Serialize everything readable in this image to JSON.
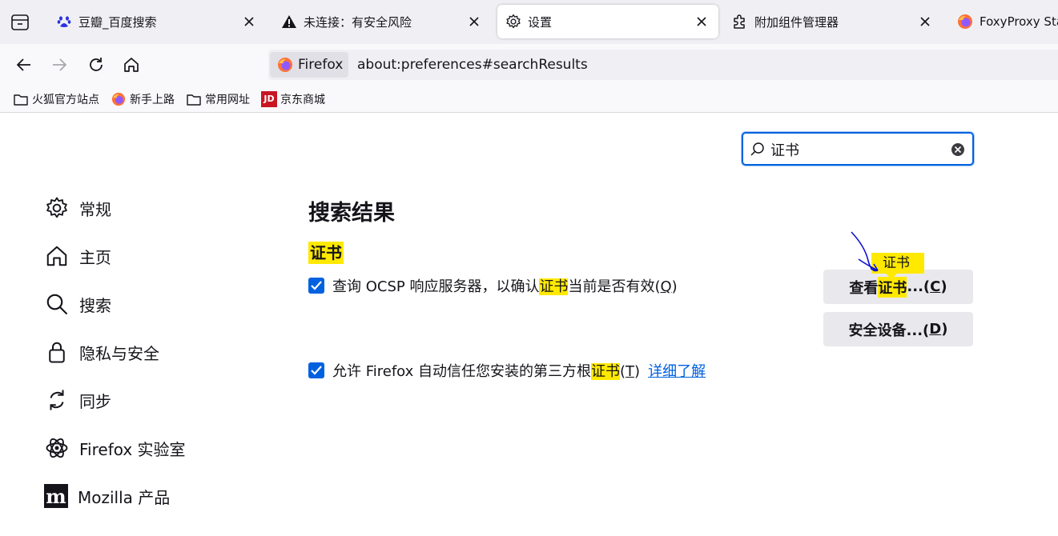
{
  "tabs": [
    {
      "label": "豆瓣_百度搜索",
      "icon": "baidu-paw-icon"
    },
    {
      "label": "未连接：有安全风险",
      "icon": "warning-icon"
    },
    {
      "label": "设置",
      "icon": "gear-icon",
      "selected": true
    },
    {
      "label": "附加组件管理器",
      "icon": "puzzle-icon"
    },
    {
      "label": "FoxyProxy Stan",
      "icon": "firefox-icon"
    }
  ],
  "urlbar": {
    "identity_label": "Firefox",
    "url": "about:preferences#searchResults"
  },
  "bookmarks": [
    {
      "label": "火狐官方站点",
      "icon": "folder-icon"
    },
    {
      "label": "新手上路",
      "icon": "firefox-icon"
    },
    {
      "label": "常用网址",
      "icon": "folder-icon"
    },
    {
      "label": "京东商城",
      "icon": "jd-icon",
      "icon_text": "JD"
    }
  ],
  "search": {
    "value": "证书"
  },
  "sidebar": {
    "items": [
      {
        "label": "常规",
        "icon": "gear-icon"
      },
      {
        "label": "主页",
        "icon": "home-icon"
      },
      {
        "label": "搜索",
        "icon": "search-icon"
      },
      {
        "label": "隐私与安全",
        "icon": "lock-icon"
      },
      {
        "label": "同步",
        "icon": "sync-icon"
      },
      {
        "label": "Firefox 实验室",
        "icon": "labs-icon"
      },
      {
        "label": "Mozilla 产品",
        "icon": "mozilla-icon",
        "icon_text": "m"
      }
    ]
  },
  "main": {
    "title": "搜索结果",
    "section_heading": "证书",
    "ocsp": {
      "before": "查询 OCSP 响应服务器，以确认",
      "highlight": "证书",
      "after": "当前是否有效(",
      "key": "Q",
      "end": ")"
    },
    "third_party": {
      "before": "允许 Firefox 自动信任您安装的第三方根",
      "highlight": "证书",
      "after": "(",
      "key": "T",
      "end": ")",
      "link": "详细了解"
    },
    "view_cert_button": {
      "before": "查看",
      "highlight": "证书",
      "after": "...(",
      "key": "C",
      "end": ")"
    },
    "security_devices_button": {
      "before": "安全设备...(",
      "key": "D",
      "end": ")"
    },
    "tooltip": "证书"
  },
  "colors": {
    "accent": "#0061e0",
    "highlight": "#ffe900",
    "annotation": "#1010d0"
  }
}
